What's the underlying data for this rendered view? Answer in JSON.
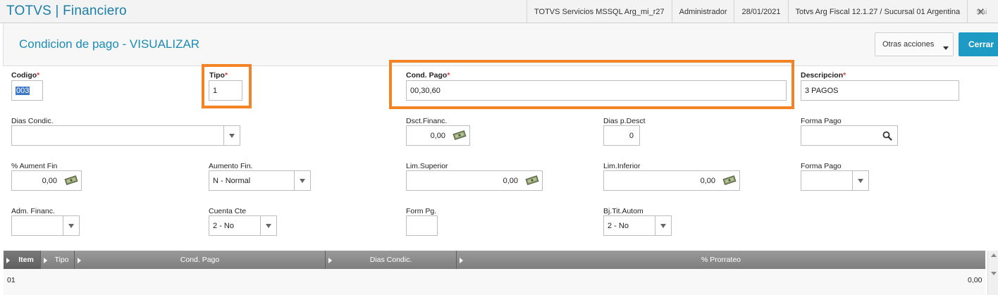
{
  "topbar": {
    "app_title": "TOTVS | Financiero",
    "server": "TOTVS Servicios MSSQL Arg_mi_r27",
    "user": "Administrador",
    "date": "28/01/2021",
    "branch": "Totvs Arg Fiscal 12.1.27 / Sucursal 01 Argentina",
    "close_label": "Sai"
  },
  "header": {
    "title": "Condicion de pago - VISUALIZAR",
    "other_actions_label": "Otras acciones",
    "close_button_label": "Cerrar"
  },
  "form": {
    "required_mark": "*",
    "codigo": {
      "label": "Codigo",
      "value": "003"
    },
    "tipo": {
      "label": "Tipo",
      "value": "1"
    },
    "cond_pago": {
      "label": "Cond. Pago",
      "value": "00,30,60"
    },
    "descripcion": {
      "label": "Descripcion",
      "value": "3 PAGOS"
    },
    "dias_condic": {
      "label": "Dias Condic.",
      "value": ""
    },
    "dsct_financ": {
      "label": "Dsct.Financ.",
      "value": "0,00"
    },
    "dias_p_desct": {
      "label": "Dias p.Desct",
      "value": "0"
    },
    "forma_pago_1": {
      "label": "Forma Pago",
      "value": ""
    },
    "aument_fin": {
      "label": "% Aument Fin",
      "value": "0,00"
    },
    "aumento_fin": {
      "label": "Aumento Fin.",
      "value": "N - Normal"
    },
    "lim_superior": {
      "label": "Lim.Superior",
      "value": "0,00"
    },
    "lim_inferior": {
      "label": "Lim.Inferior",
      "value": "0,00"
    },
    "forma_pago_2": {
      "label": "Forma Pago",
      "value": ""
    },
    "adm_financ": {
      "label": "Adm. Financ.",
      "value": ""
    },
    "cuenta_cte": {
      "label": "Cuenta Cte",
      "value": "2 - No"
    },
    "form_pg": {
      "label": "Form Pg.",
      "value": ""
    },
    "bj_tit_autom": {
      "label": "Bj.Tit.Autom",
      "value": "2 - No"
    }
  },
  "grid": {
    "columns": [
      "Item",
      "Tipo",
      "Cond. Pago",
      "Dias Condic.",
      "% Prorrateo"
    ],
    "rows": [
      {
        "item": "01",
        "prorrateo": "0,00"
      }
    ]
  },
  "colors": {
    "accent": "#1e9bc4",
    "title": "#1b8bb4",
    "highlight": "#f28425",
    "required": "#e23b3b"
  },
  "icons": [
    "money-icon",
    "search-icon",
    "chevron-down-icon",
    "close-icon"
  ]
}
